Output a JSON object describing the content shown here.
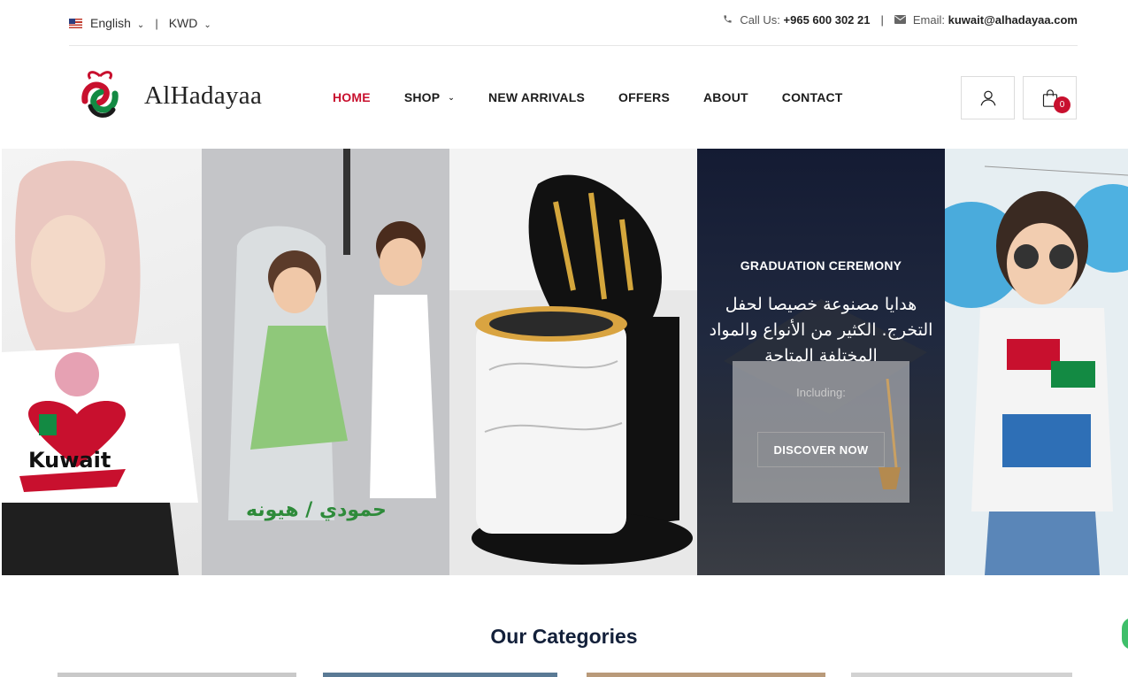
{
  "topbar": {
    "language": "English",
    "currency": "KWD",
    "call_label": "Call Us:",
    "phone": "+965 600 302 21",
    "email_label": "Email:",
    "email": "kuwait@alhadayaa.com"
  },
  "header": {
    "brand": "AlHadayaa",
    "nav": [
      "HOME",
      "SHOP",
      "NEW ARRIVALS",
      "OFFERS",
      "ABOUT",
      "CONTACT"
    ],
    "cart_count": "0"
  },
  "hero": {
    "title": "GRADUATION CEREMONY",
    "arabic": "هدايا مصنوعة خصيصا لحفل التخرج. الكثير من الأنواع والمواد المختلفة المتاحة",
    "subtitle": "Including:",
    "cta": "DISCOVER NOW"
  },
  "sections": {
    "categories_heading": "Our Categories"
  },
  "colors": {
    "accent": "#c8102e",
    "heading": "#13203a"
  }
}
